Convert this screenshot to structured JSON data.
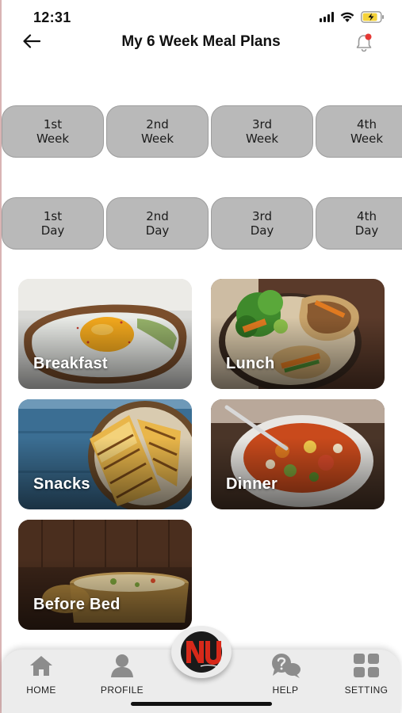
{
  "status_bar": {
    "time": "12:31",
    "battery_color": "#f4d23a"
  },
  "header": {
    "title": "My 6 Week Meal Plans",
    "notification_dot_color": "#e53935"
  },
  "weeks": [
    {
      "line1": "1st",
      "line2": "Week"
    },
    {
      "line1": "2nd",
      "line2": "Week"
    },
    {
      "line1": "3rd",
      "line2": "Week"
    },
    {
      "line1": "4th",
      "line2": "Week"
    }
  ],
  "days": [
    {
      "line1": "1st",
      "line2": "Day"
    },
    {
      "line1": "2nd",
      "line2": "Day"
    },
    {
      "line1": "3rd",
      "line2": "Day"
    },
    {
      "line1": "4th",
      "line2": "Day"
    }
  ],
  "meals": [
    {
      "label": "Breakfast"
    },
    {
      "label": "Lunch"
    },
    {
      "label": "Snacks"
    },
    {
      "label": "Dinner"
    },
    {
      "label": "Before Bed"
    }
  ],
  "bottom_nav": {
    "items": [
      {
        "label": "HOME",
        "icon": "home-icon"
      },
      {
        "label": "PROFILE",
        "icon": "profile-icon"
      },
      {
        "label": "HELP",
        "icon": "help-icon"
      },
      {
        "label": "SETTING",
        "icon": "grid-icon"
      }
    ],
    "logo_text": "NU",
    "logo_color": "#d8291a"
  },
  "colors": {
    "pill_bg": "#b9b9b9",
    "nav_bg": "#ececec",
    "icon_gray": "#8c8c8c"
  }
}
